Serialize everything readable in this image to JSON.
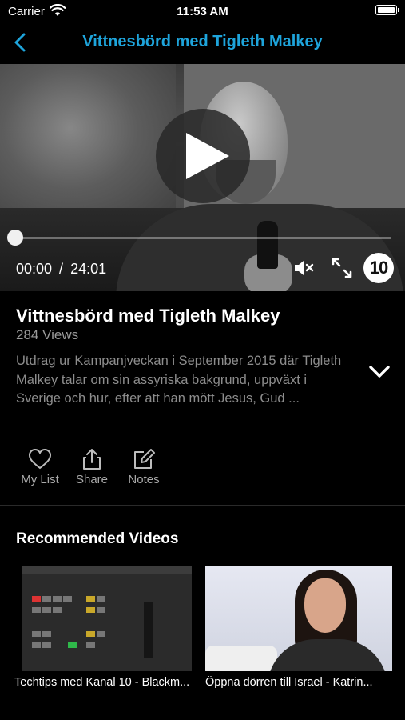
{
  "status_bar": {
    "carrier": "Carrier",
    "time": "11:53 AM"
  },
  "nav": {
    "title": "Vittnesbörd med Tigleth Malkey",
    "back_icon": "chevron-left-icon"
  },
  "player": {
    "current_time": "00:00",
    "separator": "/",
    "duration": "24:01",
    "channel_logo": "10",
    "progress_fraction": 0
  },
  "video_info": {
    "title": "Vittnesbörd med Tigleth Malkey",
    "views": "284 Views",
    "description": "Utdrag ur Kampanjveckan i September 2015 där Tigleth Malkey talar om sin assyriska bakgrund, uppväxt i Sverige och hur, efter att han mött Jesus, Gud ..."
  },
  "actions": [
    {
      "label": "My List",
      "icon": "heart-icon"
    },
    {
      "label": "Share",
      "icon": "share-icon"
    },
    {
      "label": "Notes",
      "icon": "edit-icon"
    }
  ],
  "recommended": {
    "heading": "Recommended Videos",
    "items": [
      {
        "title": "Techtips med Kanal 10 - Blackm..."
      },
      {
        "title": "Öppna dörren till Israel - Katrin..."
      }
    ]
  },
  "colors": {
    "accent": "#1ea4db",
    "background": "#000000",
    "muted_text": "#8d8d8d"
  }
}
